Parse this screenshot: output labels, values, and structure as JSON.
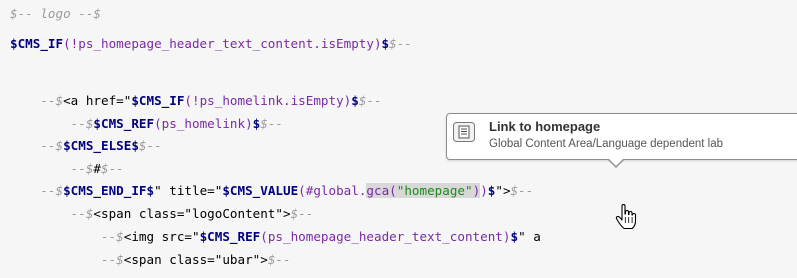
{
  "code_lines": [
    {
      "indent": "",
      "tokens": [
        {
          "t": "$-- logo --$",
          "c": "comment"
        }
      ]
    },
    {
      "indent": "",
      "tokens": [
        {
          "t": "$CMS_IF",
          "c": "cms"
        },
        {
          "t": "(!ps_homepage_header_text_content.isEmpty)",
          "c": "fn"
        },
        {
          "t": "$",
          "c": "cms"
        },
        {
          "t": "$--",
          "c": "comment"
        }
      ]
    },
    {
      "indent": "",
      "tokens": []
    },
    {
      "indent": "    ",
      "tokens": [
        {
          "t": "--$",
          "c": "comment"
        },
        {
          "t": "<a href=\"",
          "c": "plain"
        },
        {
          "t": "$CMS_IF",
          "c": "cms"
        },
        {
          "t": "(!ps_homelink.isEmpty)",
          "c": "fn"
        },
        {
          "t": "$",
          "c": "cms"
        },
        {
          "t": "$--",
          "c": "comment"
        }
      ]
    },
    {
      "indent": "        ",
      "tokens": [
        {
          "t": "--$",
          "c": "comment"
        },
        {
          "t": "$CMS_REF",
          "c": "cms"
        },
        {
          "t": "(ps_homelink)",
          "c": "fn"
        },
        {
          "t": "$",
          "c": "cms"
        },
        {
          "t": "$--",
          "c": "comment"
        }
      ]
    },
    {
      "indent": "    ",
      "tokens": [
        {
          "t": "--$",
          "c": "comment"
        },
        {
          "t": "$CMS_ELSE$",
          "c": "cms"
        },
        {
          "t": "$--",
          "c": "comment"
        }
      ]
    },
    {
      "indent": "        ",
      "tokens": [
        {
          "t": "--$",
          "c": "comment"
        },
        {
          "t": "#",
          "c": "plain"
        },
        {
          "t": "$--",
          "c": "comment"
        }
      ]
    },
    {
      "indent": "    ",
      "tokens": [
        {
          "t": "--$",
          "c": "comment"
        },
        {
          "t": "$CMS_END_IF$",
          "c": "cms"
        },
        {
          "t": "\" title=\"",
          "c": "plain"
        },
        {
          "t": "$CMS_VALUE",
          "c": "cms"
        },
        {
          "t": "(#global.",
          "c": "fn"
        },
        {
          "t": "gca(",
          "c": "fn hl"
        },
        {
          "t": "\"homepage\"",
          "c": "str-hl"
        },
        {
          "t": ")",
          "c": "fn hl"
        },
        {
          "t": ")",
          "c": "fn"
        },
        {
          "t": "$",
          "c": "cms"
        },
        {
          "t": "\">",
          "c": "plain"
        },
        {
          "t": "$--",
          "c": "comment"
        }
      ]
    },
    {
      "indent": "        ",
      "tokens": [
        {
          "t": "--$",
          "c": "comment"
        },
        {
          "t": "<span class=\"logoContent\">",
          "c": "plain"
        },
        {
          "t": "$--",
          "c": "comment"
        }
      ]
    },
    {
      "indent": "            ",
      "tokens": [
        {
          "t": "--$",
          "c": "comment"
        },
        {
          "t": "<img src=\"",
          "c": "plain"
        },
        {
          "t": "$CMS_REF",
          "c": "cms"
        },
        {
          "t": "(ps_homepage_header_text_content)",
          "c": "fn"
        },
        {
          "t": "$",
          "c": "cms"
        },
        {
          "t": "\" a",
          "c": "plain"
        }
      ]
    },
    {
      "indent": "            ",
      "tokens": [
        {
          "t": "--$",
          "c": "comment"
        },
        {
          "t": "<span class=\"ubar\">",
          "c": "plain"
        },
        {
          "t": "$--",
          "c": "comment"
        }
      ]
    }
  ],
  "tooltip": {
    "title": "Link to homepage",
    "description": "Global Content Area/Language dependent lab",
    "icon": "document-icon"
  },
  "cursor": {
    "icon": "hand-pointer-icon"
  },
  "colors": {
    "background": "#f6f6f6",
    "cms_keyword": "#000080",
    "function": "#7a2aa6",
    "string": "#1b8a1b",
    "comment": "#9a9a9a",
    "highlight": "#d8d8d8"
  }
}
